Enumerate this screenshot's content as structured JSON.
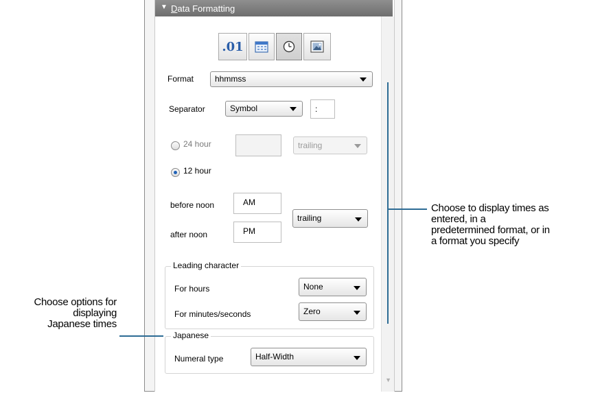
{
  "panel": {
    "title_prefix": "D",
    "title_rest": "ata Formatting",
    "toolbar": {
      "number_label": ".01",
      "icons": [
        "number-icon",
        "calendar-icon",
        "clock-icon",
        "image-icon"
      ],
      "active": "clock-icon"
    },
    "format": {
      "label": "Format",
      "value": "hhmmss"
    },
    "separator": {
      "label": "Separator",
      "value": "Symbol",
      "symbol": ":"
    },
    "hour24": {
      "label": "24 hour",
      "input": "",
      "position": "trailing",
      "checked": false
    },
    "hour12": {
      "label": "12 hour",
      "checked": true
    },
    "before_noon": {
      "label": "before noon",
      "value": "AM"
    },
    "after_noon": {
      "label": "after noon",
      "value": "PM"
    },
    "ampm_position": "trailing",
    "leading": {
      "title": "Leading character",
      "hours_label": "For hours",
      "hours_value": "None",
      "minsec_label": "For minutes/seconds",
      "minsec_value": "Zero"
    },
    "japanese": {
      "title": "Japanese",
      "numeral_label": "Numeral type",
      "numeral_value": "Half-Width"
    }
  },
  "callouts": {
    "right": [
      "Choose to display times as",
      "entered, in a",
      "predetermined format, or in",
      "a format you specify"
    ],
    "left": [
      "Choose options for",
      "displaying",
      "Japanese times"
    ]
  },
  "colors": {
    "accent": "#2c6b94",
    "header": "#7a7a7a",
    "number_icon": "#2a5ea9"
  }
}
